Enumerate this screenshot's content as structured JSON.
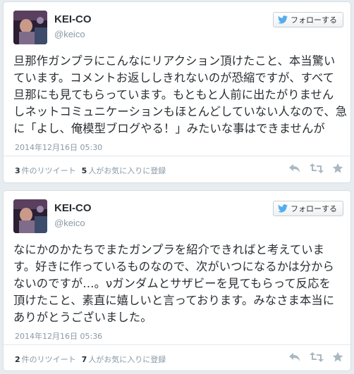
{
  "tweets": [
    {
      "name": "KEI-CO",
      "handle": "@keico",
      "follow_label": "フォローする",
      "lines": [
        "旦那作ガンプラにこんなにリアクション頂けたこと、本当驚い",
        "ています。コメントお返ししきれないのが恐縮ですが、すべて",
        "旦那にも見てもらっています。もともと人前に出たがりません",
        "しネットコミュニケーションもほとんどしていない人なので、急",
        "に「よし、俺模型ブログやる！」みたいな事はできませんが"
      ],
      "timestamp": "2014年12月16日 05:30",
      "retweet_count": "3",
      "retweet_label": "件のリツイート",
      "fav_count": "5",
      "fav_label": "人がお気に入りに登録"
    },
    {
      "name": "KEI-CO",
      "handle": "@keico",
      "follow_label": "フォローする",
      "lines": [
        "なにかのかたちでまたガンプラを紹介できればと考えていま",
        "す。好きに作っているものなので、次がいつになるかは分から",
        "ないのですが…。νガンダムとサザビーを見てもらって反応を",
        "頂けたこと、素直に嬉しいと言っております。みなさま本当に",
        "ありがとうございました。"
      ],
      "timestamp": "2014年12月16日 05:36",
      "retweet_count": "2",
      "retweet_label": "件のリツイート",
      "fav_count": "7",
      "fav_label": "人がお気に入りに登録"
    }
  ],
  "icons": {
    "follow": "twitter-bird-icon",
    "reply": "reply-icon",
    "retweet": "retweet-icon",
    "favorite": "star-icon"
  },
  "colors": {
    "background": "#e6ecf0",
    "name": "#292f33",
    "muted": "#8899a6",
    "twitter_blue": "#55acee"
  }
}
